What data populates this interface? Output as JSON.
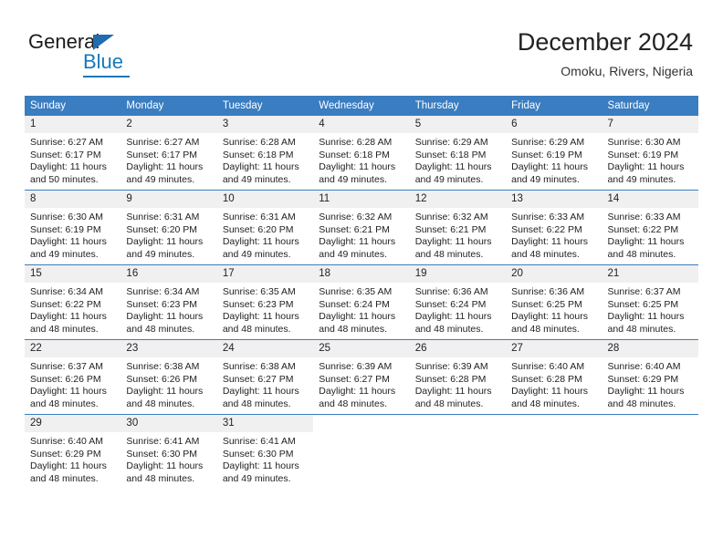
{
  "logo": {
    "word_one": "General",
    "word_two": "Blue",
    "triangle_color": "#1f6cb0",
    "blue_color": "#1779ba"
  },
  "header": {
    "title": "December 2024",
    "subtitle": "Omoku, Rivers, Nigeria"
  },
  "theme": {
    "header_row_bg": "#3a7dc0",
    "daynum_bg": "#f0f0f0",
    "grid_line": "#3a7dc0",
    "text": "#222222"
  },
  "weekday_headers": [
    "Sunday",
    "Monday",
    "Tuesday",
    "Wednesday",
    "Thursday",
    "Friday",
    "Saturday"
  ],
  "labels": {
    "sunrise_prefix": "Sunrise:",
    "sunset_prefix": "Sunset:",
    "daylight_prefix": "Daylight:"
  },
  "weeks": [
    [
      {
        "day": "1",
        "sunrise": "Sunrise: 6:27 AM",
        "sunset": "Sunset: 6:17 PM",
        "daylight_1": "Daylight: 11 hours",
        "daylight_2": "and 50 minutes."
      },
      {
        "day": "2",
        "sunrise": "Sunrise: 6:27 AM",
        "sunset": "Sunset: 6:17 PM",
        "daylight_1": "Daylight: 11 hours",
        "daylight_2": "and 49 minutes."
      },
      {
        "day": "3",
        "sunrise": "Sunrise: 6:28 AM",
        "sunset": "Sunset: 6:18 PM",
        "daylight_1": "Daylight: 11 hours",
        "daylight_2": "and 49 minutes."
      },
      {
        "day": "4",
        "sunrise": "Sunrise: 6:28 AM",
        "sunset": "Sunset: 6:18 PM",
        "daylight_1": "Daylight: 11 hours",
        "daylight_2": "and 49 minutes."
      },
      {
        "day": "5",
        "sunrise": "Sunrise: 6:29 AM",
        "sunset": "Sunset: 6:18 PM",
        "daylight_1": "Daylight: 11 hours",
        "daylight_2": "and 49 minutes."
      },
      {
        "day": "6",
        "sunrise": "Sunrise: 6:29 AM",
        "sunset": "Sunset: 6:19 PM",
        "daylight_1": "Daylight: 11 hours",
        "daylight_2": "and 49 minutes."
      },
      {
        "day": "7",
        "sunrise": "Sunrise: 6:30 AM",
        "sunset": "Sunset: 6:19 PM",
        "daylight_1": "Daylight: 11 hours",
        "daylight_2": "and 49 minutes."
      }
    ],
    [
      {
        "day": "8",
        "sunrise": "Sunrise: 6:30 AM",
        "sunset": "Sunset: 6:19 PM",
        "daylight_1": "Daylight: 11 hours",
        "daylight_2": "and 49 minutes."
      },
      {
        "day": "9",
        "sunrise": "Sunrise: 6:31 AM",
        "sunset": "Sunset: 6:20 PM",
        "daylight_1": "Daylight: 11 hours",
        "daylight_2": "and 49 minutes."
      },
      {
        "day": "10",
        "sunrise": "Sunrise: 6:31 AM",
        "sunset": "Sunset: 6:20 PM",
        "daylight_1": "Daylight: 11 hours",
        "daylight_2": "and 49 minutes."
      },
      {
        "day": "11",
        "sunrise": "Sunrise: 6:32 AM",
        "sunset": "Sunset: 6:21 PM",
        "daylight_1": "Daylight: 11 hours",
        "daylight_2": "and 49 minutes."
      },
      {
        "day": "12",
        "sunrise": "Sunrise: 6:32 AM",
        "sunset": "Sunset: 6:21 PM",
        "daylight_1": "Daylight: 11 hours",
        "daylight_2": "and 48 minutes."
      },
      {
        "day": "13",
        "sunrise": "Sunrise: 6:33 AM",
        "sunset": "Sunset: 6:22 PM",
        "daylight_1": "Daylight: 11 hours",
        "daylight_2": "and 48 minutes."
      },
      {
        "day": "14",
        "sunrise": "Sunrise: 6:33 AM",
        "sunset": "Sunset: 6:22 PM",
        "daylight_1": "Daylight: 11 hours",
        "daylight_2": "and 48 minutes."
      }
    ],
    [
      {
        "day": "15",
        "sunrise": "Sunrise: 6:34 AM",
        "sunset": "Sunset: 6:22 PM",
        "daylight_1": "Daylight: 11 hours",
        "daylight_2": "and 48 minutes."
      },
      {
        "day": "16",
        "sunrise": "Sunrise: 6:34 AM",
        "sunset": "Sunset: 6:23 PM",
        "daylight_1": "Daylight: 11 hours",
        "daylight_2": "and 48 minutes."
      },
      {
        "day": "17",
        "sunrise": "Sunrise: 6:35 AM",
        "sunset": "Sunset: 6:23 PM",
        "daylight_1": "Daylight: 11 hours",
        "daylight_2": "and 48 minutes."
      },
      {
        "day": "18",
        "sunrise": "Sunrise: 6:35 AM",
        "sunset": "Sunset: 6:24 PM",
        "daylight_1": "Daylight: 11 hours",
        "daylight_2": "and 48 minutes."
      },
      {
        "day": "19",
        "sunrise": "Sunrise: 6:36 AM",
        "sunset": "Sunset: 6:24 PM",
        "daylight_1": "Daylight: 11 hours",
        "daylight_2": "and 48 minutes."
      },
      {
        "day": "20",
        "sunrise": "Sunrise: 6:36 AM",
        "sunset": "Sunset: 6:25 PM",
        "daylight_1": "Daylight: 11 hours",
        "daylight_2": "and 48 minutes."
      },
      {
        "day": "21",
        "sunrise": "Sunrise: 6:37 AM",
        "sunset": "Sunset: 6:25 PM",
        "daylight_1": "Daylight: 11 hours",
        "daylight_2": "and 48 minutes."
      }
    ],
    [
      {
        "day": "22",
        "sunrise": "Sunrise: 6:37 AM",
        "sunset": "Sunset: 6:26 PM",
        "daylight_1": "Daylight: 11 hours",
        "daylight_2": "and 48 minutes."
      },
      {
        "day": "23",
        "sunrise": "Sunrise: 6:38 AM",
        "sunset": "Sunset: 6:26 PM",
        "daylight_1": "Daylight: 11 hours",
        "daylight_2": "and 48 minutes."
      },
      {
        "day": "24",
        "sunrise": "Sunrise: 6:38 AM",
        "sunset": "Sunset: 6:27 PM",
        "daylight_1": "Daylight: 11 hours",
        "daylight_2": "and 48 minutes."
      },
      {
        "day": "25",
        "sunrise": "Sunrise: 6:39 AM",
        "sunset": "Sunset: 6:27 PM",
        "daylight_1": "Daylight: 11 hours",
        "daylight_2": "and 48 minutes."
      },
      {
        "day": "26",
        "sunrise": "Sunrise: 6:39 AM",
        "sunset": "Sunset: 6:28 PM",
        "daylight_1": "Daylight: 11 hours",
        "daylight_2": "and 48 minutes."
      },
      {
        "day": "27",
        "sunrise": "Sunrise: 6:40 AM",
        "sunset": "Sunset: 6:28 PM",
        "daylight_1": "Daylight: 11 hours",
        "daylight_2": "and 48 minutes."
      },
      {
        "day": "28",
        "sunrise": "Sunrise: 6:40 AM",
        "sunset": "Sunset: 6:29 PM",
        "daylight_1": "Daylight: 11 hours",
        "daylight_2": "and 48 minutes."
      }
    ],
    [
      {
        "day": "29",
        "sunrise": "Sunrise: 6:40 AM",
        "sunset": "Sunset: 6:29 PM",
        "daylight_1": "Daylight: 11 hours",
        "daylight_2": "and 48 minutes."
      },
      {
        "day": "30",
        "sunrise": "Sunrise: 6:41 AM",
        "sunset": "Sunset: 6:30 PM",
        "daylight_1": "Daylight: 11 hours",
        "daylight_2": "and 48 minutes."
      },
      {
        "day": "31",
        "sunrise": "Sunrise: 6:41 AM",
        "sunset": "Sunset: 6:30 PM",
        "daylight_1": "Daylight: 11 hours",
        "daylight_2": "and 49 minutes."
      },
      {
        "day": "",
        "sunrise": "",
        "sunset": "",
        "daylight_1": "",
        "daylight_2": ""
      },
      {
        "day": "",
        "sunrise": "",
        "sunset": "",
        "daylight_1": "",
        "daylight_2": ""
      },
      {
        "day": "",
        "sunrise": "",
        "sunset": "",
        "daylight_1": "",
        "daylight_2": ""
      },
      {
        "day": "",
        "sunrise": "",
        "sunset": "",
        "daylight_1": "",
        "daylight_2": ""
      }
    ]
  ]
}
